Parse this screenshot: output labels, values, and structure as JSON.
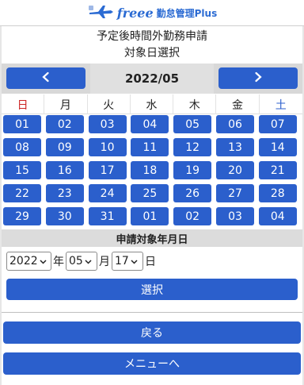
{
  "header": {
    "logo_text": "freee",
    "logo_sub": "勤怠管理Plus",
    "logo_icon": "airplane-logo-icon"
  },
  "title": {
    "line1": "予定後時間外勤務申請",
    "line2": "対象日選択"
  },
  "calendar": {
    "prev_icon": "chevron-left-icon",
    "next_icon": "chevron-right-icon",
    "month": "2022/05",
    "weekdays": [
      "日",
      "月",
      "火",
      "水",
      "木",
      "金",
      "土"
    ],
    "weeks": [
      [
        "01",
        "02",
        "03",
        "04",
        "05",
        "06",
        "07"
      ],
      [
        "08",
        "09",
        "10",
        "11",
        "12",
        "13",
        "14"
      ],
      [
        "15",
        "16",
        "17",
        "18",
        "19",
        "20",
        "21"
      ],
      [
        "22",
        "23",
        "24",
        "25",
        "26",
        "27",
        "28"
      ],
      [
        "29",
        "30",
        "31",
        "01",
        "02",
        "03",
        "04"
      ]
    ]
  },
  "target": {
    "heading": "申請対象年月日",
    "year": "2022",
    "year_unit": "年",
    "month": "05",
    "month_unit": "月",
    "day": "17",
    "day_unit": "日"
  },
  "buttons": {
    "select": "選択",
    "back": "戻る",
    "menu": "メニューへ"
  },
  "colors": {
    "accent": "#2b5fcc",
    "sunday": "#cc2222",
    "saturday": "#2b5fcc"
  }
}
